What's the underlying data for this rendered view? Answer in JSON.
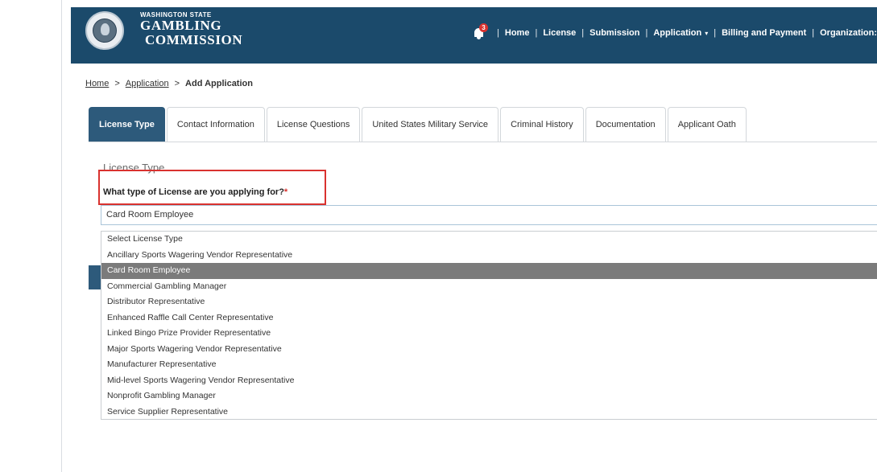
{
  "header": {
    "logo_state": "WASHINGTON STATE",
    "logo_line1": "GAMBLING",
    "logo_line2": "COMMISSION",
    "notification_count": "3",
    "nav": {
      "home": "Home",
      "license": "License",
      "submission": "Submission",
      "application": "Application",
      "billing": "Billing and Payment",
      "organization": "Organization:"
    },
    "separator": "|",
    "caret": "▾"
  },
  "breadcrumb": {
    "home": "Home",
    "application": "Application",
    "current": "Add Application",
    "separator": ">"
  },
  "tabs": [
    {
      "label": "License Type"
    },
    {
      "label": "Contact Information"
    },
    {
      "label": "License Questions"
    },
    {
      "label": "United States Military Service"
    },
    {
      "label": "Criminal History"
    },
    {
      "label": "Documentation"
    },
    {
      "label": "Applicant Oath"
    }
  ],
  "section": {
    "title": "License Type",
    "question": "What type of License are you applying for?",
    "required_mark": "*"
  },
  "select": {
    "value": "Card Room Employee"
  },
  "options": [
    {
      "label": "Select License Type"
    },
    {
      "label": "Ancillary Sports Wagering Vendor Representative"
    },
    {
      "label": "Card Room Employee"
    },
    {
      "label": "Commercial Gambling Manager"
    },
    {
      "label": "Distributor Representative"
    },
    {
      "label": "Enhanced Raffle Call Center Representative"
    },
    {
      "label": "Linked Bingo Prize Provider Representative"
    },
    {
      "label": "Major Sports Wagering Vendor Representative"
    },
    {
      "label": "Manufacturer Representative"
    },
    {
      "label": "Mid-level Sports Wagering Vendor Representative"
    },
    {
      "label": "Nonprofit Gambling Manager"
    },
    {
      "label": "Service Supplier Representative"
    }
  ],
  "colors": {
    "header_bg": "#1b4a6b",
    "active_tab": "#2d5a7b",
    "highlight": "#d9322f",
    "selected_option": "#7b7b7b"
  }
}
